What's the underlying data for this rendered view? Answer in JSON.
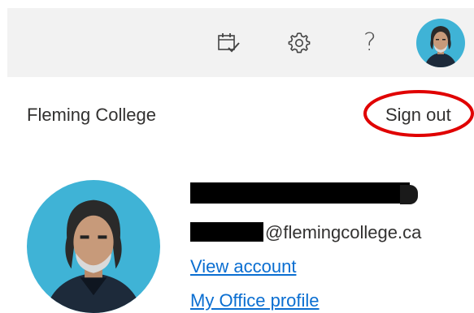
{
  "header": {
    "icons": [
      "calendar-check-icon",
      "gear-icon",
      "help-icon",
      "avatar"
    ],
    "help_glyph": "?"
  },
  "account": {
    "organization": "Fleming College",
    "sign_out_label": "Sign out",
    "email_domain": "@flemingcollege.ca",
    "view_account_label": "View account",
    "office_profile_label": "My Office profile"
  },
  "colors": {
    "topbar_bg": "#f2f2f2",
    "link": "#0a6ed1",
    "annotation_circle": "#e00000",
    "avatar_bg": "#3fb3d6"
  }
}
